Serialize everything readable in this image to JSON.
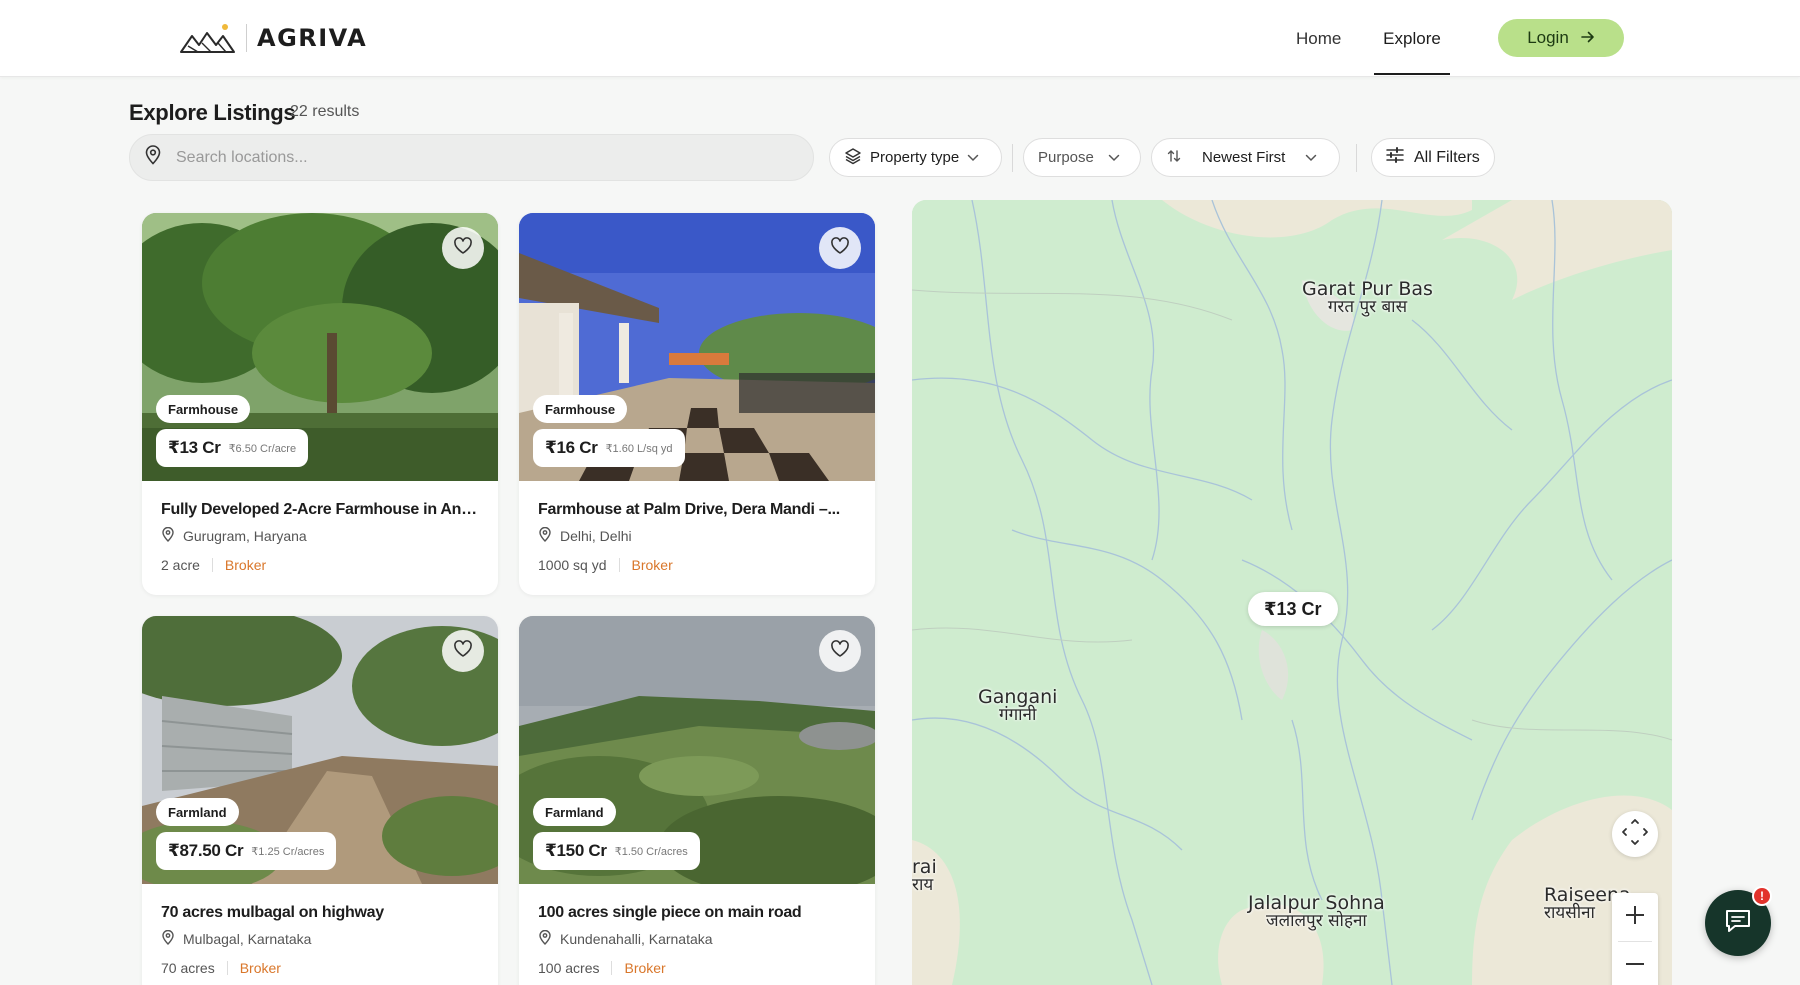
{
  "header": {
    "brand": "AGRIVA",
    "nav": {
      "home": "Home",
      "explore": "Explore"
    },
    "login_label": "Login"
  },
  "title": {
    "heading": "Explore Listings",
    "count": "22 results"
  },
  "search": {
    "placeholder": "Search locations...",
    "value": ""
  },
  "filters": {
    "property_type": "Property type",
    "purpose": "Purpose",
    "sort": "Newest First",
    "all_filters": "All Filters"
  },
  "listings": [
    {
      "type": "Farmhouse",
      "price": "₹13 Cr",
      "rate": "₹6.50 Cr/acre",
      "title": "Fully Developed 2-Acre Farmhouse in Ans...",
      "location": "Gurugram, Haryana",
      "size": "2 acre",
      "seller": "Broker"
    },
    {
      "type": "Farmhouse",
      "price": "₹16 Cr",
      "rate": "₹1.60 L/sq yd",
      "title": "Farmhouse at Palm Drive, Dera Mandi –...",
      "location": "Delhi, Delhi",
      "size": "1000 sq yd",
      "seller": "Broker"
    },
    {
      "type": "Farmland",
      "price": "₹87.50 Cr",
      "rate": "₹1.25 Cr/acres",
      "title": "70 acres mulbagal on highway",
      "location": "Mulbagal, Karnataka",
      "size": "70 acres",
      "seller": "Broker"
    },
    {
      "type": "Farmland",
      "price": "₹150 Cr",
      "rate": "₹1.50 Cr/acres",
      "title": "100 acres single piece on main road",
      "location": "Kundenahalli, Karnataka",
      "size": "100 acres",
      "seller": "Broker"
    }
  ],
  "map": {
    "labels": [
      {
        "en": "Garat Pur Bas",
        "hi": "गरत पुर बास"
      },
      {
        "en": "Gangani",
        "hi": "गंगानी"
      },
      {
        "en": "Jalalpur Sohna",
        "hi": "जलालपुर सोहना"
      },
      {
        "en": "Raiseena",
        "hi": "रायसीना"
      },
      {
        "en": "rai",
        "hi": "राय"
      }
    ],
    "price_marker": "₹13 Cr"
  },
  "chat": {
    "badge": "!"
  },
  "colors": {
    "accent": "#b9e08a",
    "broker": "#d9772b",
    "map_green": "#cfeccf",
    "chat_bg": "#16352a",
    "badge_red": "#e2332c"
  },
  "icons": {
    "logo": "mountain-sun-logo",
    "login": "arrow-right-icon",
    "search": "location-pin-icon",
    "property_type": "layers-icon",
    "dropdown": "chevron-down-icon",
    "sort": "sort-arrows-icon",
    "filters": "sliders-icon",
    "favorite": "heart-icon",
    "location": "location-pin-icon",
    "expand": "expand-arrows-icon",
    "zoom_in": "plus-icon",
    "zoom_out": "minus-icon",
    "chat": "chat-bubble-icon"
  }
}
